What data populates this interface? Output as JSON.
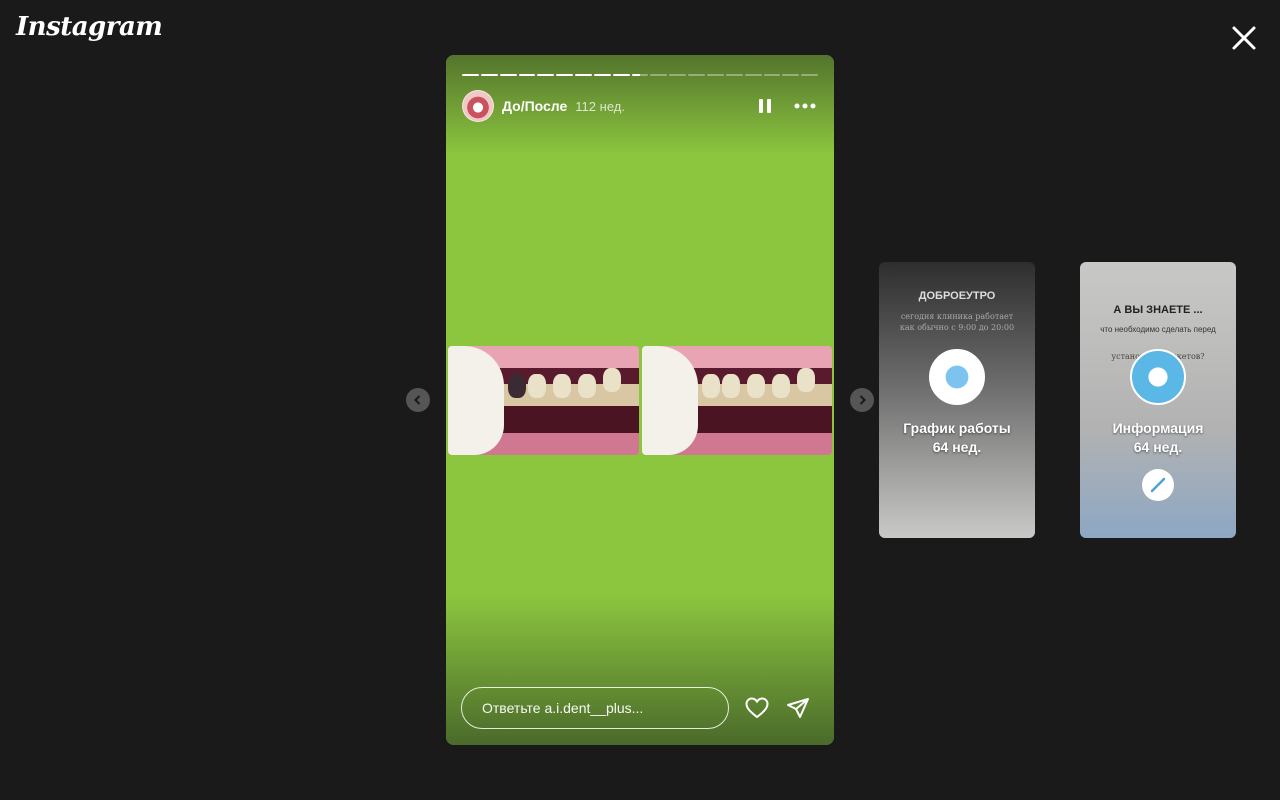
{
  "app": {
    "logo": "Instagram"
  },
  "story": {
    "title": "До/После",
    "time": "112 нед.",
    "progress": {
      "segments": 19,
      "completed": 9,
      "current_fraction": 0.5
    },
    "reply_placeholder": "Ответьте a.i.dent__plus..."
  },
  "previews": [
    {
      "name": "График работы",
      "time": "64 нед.",
      "bg_lines": [
        "ДОБРОЕУТРО",
        "сегодня клиника работает",
        "как обычно с 9:00 до 20:00"
      ]
    },
    {
      "name": "Информация",
      "time": "64 нед.",
      "bg_lines": [
        "А ВЫ ЗНАЕТЕ ...",
        "что необходимо сделать перед",
        "установкой брекетов?"
      ]
    }
  ],
  "icons": {
    "close": "close-icon",
    "pause": "pause-icon",
    "more": "more-icon",
    "like": "heart-icon",
    "share": "send-icon",
    "prev": "chevron-left-icon",
    "next": "chevron-right-icon"
  },
  "colors": {
    "background": "#1a1a1a",
    "story_bg": "#8cc63f"
  }
}
